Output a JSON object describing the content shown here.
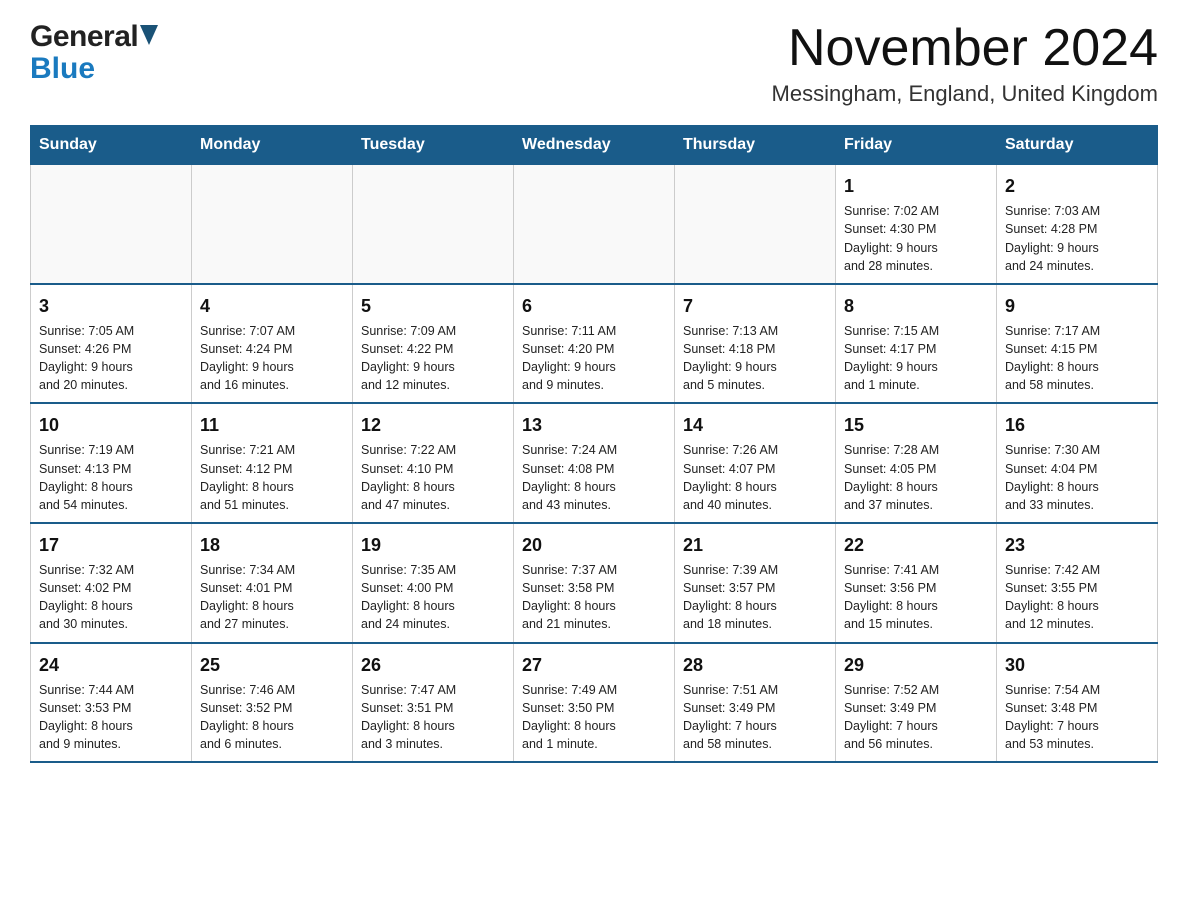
{
  "logo": {
    "general": "General",
    "blue": "Blue"
  },
  "header": {
    "month": "November 2024",
    "location": "Messingham, England, United Kingdom"
  },
  "days_of_week": [
    "Sunday",
    "Monday",
    "Tuesday",
    "Wednesday",
    "Thursday",
    "Friday",
    "Saturday"
  ],
  "weeks": [
    [
      {
        "day": "",
        "info": ""
      },
      {
        "day": "",
        "info": ""
      },
      {
        "day": "",
        "info": ""
      },
      {
        "day": "",
        "info": ""
      },
      {
        "day": "",
        "info": ""
      },
      {
        "day": "1",
        "info": "Sunrise: 7:02 AM\nSunset: 4:30 PM\nDaylight: 9 hours\nand 28 minutes."
      },
      {
        "day": "2",
        "info": "Sunrise: 7:03 AM\nSunset: 4:28 PM\nDaylight: 9 hours\nand 24 minutes."
      }
    ],
    [
      {
        "day": "3",
        "info": "Sunrise: 7:05 AM\nSunset: 4:26 PM\nDaylight: 9 hours\nand 20 minutes."
      },
      {
        "day": "4",
        "info": "Sunrise: 7:07 AM\nSunset: 4:24 PM\nDaylight: 9 hours\nand 16 minutes."
      },
      {
        "day": "5",
        "info": "Sunrise: 7:09 AM\nSunset: 4:22 PM\nDaylight: 9 hours\nand 12 minutes."
      },
      {
        "day": "6",
        "info": "Sunrise: 7:11 AM\nSunset: 4:20 PM\nDaylight: 9 hours\nand 9 minutes."
      },
      {
        "day": "7",
        "info": "Sunrise: 7:13 AM\nSunset: 4:18 PM\nDaylight: 9 hours\nand 5 minutes."
      },
      {
        "day": "8",
        "info": "Sunrise: 7:15 AM\nSunset: 4:17 PM\nDaylight: 9 hours\nand 1 minute."
      },
      {
        "day": "9",
        "info": "Sunrise: 7:17 AM\nSunset: 4:15 PM\nDaylight: 8 hours\nand 58 minutes."
      }
    ],
    [
      {
        "day": "10",
        "info": "Sunrise: 7:19 AM\nSunset: 4:13 PM\nDaylight: 8 hours\nand 54 minutes."
      },
      {
        "day": "11",
        "info": "Sunrise: 7:21 AM\nSunset: 4:12 PM\nDaylight: 8 hours\nand 51 minutes."
      },
      {
        "day": "12",
        "info": "Sunrise: 7:22 AM\nSunset: 4:10 PM\nDaylight: 8 hours\nand 47 minutes."
      },
      {
        "day": "13",
        "info": "Sunrise: 7:24 AM\nSunset: 4:08 PM\nDaylight: 8 hours\nand 43 minutes."
      },
      {
        "day": "14",
        "info": "Sunrise: 7:26 AM\nSunset: 4:07 PM\nDaylight: 8 hours\nand 40 minutes."
      },
      {
        "day": "15",
        "info": "Sunrise: 7:28 AM\nSunset: 4:05 PM\nDaylight: 8 hours\nand 37 minutes."
      },
      {
        "day": "16",
        "info": "Sunrise: 7:30 AM\nSunset: 4:04 PM\nDaylight: 8 hours\nand 33 minutes."
      }
    ],
    [
      {
        "day": "17",
        "info": "Sunrise: 7:32 AM\nSunset: 4:02 PM\nDaylight: 8 hours\nand 30 minutes."
      },
      {
        "day": "18",
        "info": "Sunrise: 7:34 AM\nSunset: 4:01 PM\nDaylight: 8 hours\nand 27 minutes."
      },
      {
        "day": "19",
        "info": "Sunrise: 7:35 AM\nSunset: 4:00 PM\nDaylight: 8 hours\nand 24 minutes."
      },
      {
        "day": "20",
        "info": "Sunrise: 7:37 AM\nSunset: 3:58 PM\nDaylight: 8 hours\nand 21 minutes."
      },
      {
        "day": "21",
        "info": "Sunrise: 7:39 AM\nSunset: 3:57 PM\nDaylight: 8 hours\nand 18 minutes."
      },
      {
        "day": "22",
        "info": "Sunrise: 7:41 AM\nSunset: 3:56 PM\nDaylight: 8 hours\nand 15 minutes."
      },
      {
        "day": "23",
        "info": "Sunrise: 7:42 AM\nSunset: 3:55 PM\nDaylight: 8 hours\nand 12 minutes."
      }
    ],
    [
      {
        "day": "24",
        "info": "Sunrise: 7:44 AM\nSunset: 3:53 PM\nDaylight: 8 hours\nand 9 minutes."
      },
      {
        "day": "25",
        "info": "Sunrise: 7:46 AM\nSunset: 3:52 PM\nDaylight: 8 hours\nand 6 minutes."
      },
      {
        "day": "26",
        "info": "Sunrise: 7:47 AM\nSunset: 3:51 PM\nDaylight: 8 hours\nand 3 minutes."
      },
      {
        "day": "27",
        "info": "Sunrise: 7:49 AM\nSunset: 3:50 PM\nDaylight: 8 hours\nand 1 minute."
      },
      {
        "day": "28",
        "info": "Sunrise: 7:51 AM\nSunset: 3:49 PM\nDaylight: 7 hours\nand 58 minutes."
      },
      {
        "day": "29",
        "info": "Sunrise: 7:52 AM\nSunset: 3:49 PM\nDaylight: 7 hours\nand 56 minutes."
      },
      {
        "day": "30",
        "info": "Sunrise: 7:54 AM\nSunset: 3:48 PM\nDaylight: 7 hours\nand 53 minutes."
      }
    ]
  ]
}
